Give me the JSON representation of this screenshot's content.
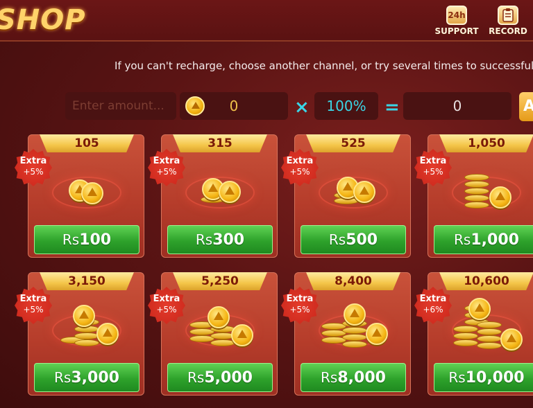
{
  "header": {
    "title": "SHOP",
    "support_label": "SUPPORT",
    "support_icon_text": "24h",
    "record_label": "RECORD"
  },
  "notice": "If you can't recharge, choose another channel, or try several times to successfully",
  "amount_row": {
    "placeholder": "Enter amount...",
    "coin_value": "0",
    "multiply_symbol": "×",
    "bonus_percent": "100%",
    "equals_symbol": "=",
    "result_value": "0",
    "action_label": "A"
  },
  "currency_prefix": "Rs",
  "packages": [
    {
      "coins": "105",
      "price": "100",
      "extra_label": "Extra",
      "extra_pct": "+5%"
    },
    {
      "coins": "315",
      "price": "300",
      "extra_label": "Extra",
      "extra_pct": "+5%"
    },
    {
      "coins": "525",
      "price": "500",
      "extra_label": "Extra",
      "extra_pct": "+5%"
    },
    {
      "coins": "1,050",
      "price": "1,000",
      "extra_label": "Extra",
      "extra_pct": "+5%"
    },
    {
      "coins": "3,150",
      "price": "3,000",
      "extra_label": "Extra",
      "extra_pct": "+5%"
    },
    {
      "coins": "5,250",
      "price": "5,000",
      "extra_label": "Extra",
      "extra_pct": "+5%"
    },
    {
      "coins": "8,400",
      "price": "8,000",
      "extra_label": "Extra",
      "extra_pct": "+5%"
    },
    {
      "coins": "10,600",
      "price": "10,000",
      "extra_label": "Extra",
      "extra_pct": "+6%"
    }
  ],
  "icons": {
    "support": "support-24h-icon",
    "record": "record-clipboard-icon",
    "coin": "gold-coin-icon"
  },
  "colors": {
    "background": "#5a1414",
    "card": "#b63d2b",
    "ribbon": "#f4c64a",
    "price_button": "#2ea22b",
    "accent_cyan": "#3ad6e6",
    "extra_badge": "#c8251a"
  }
}
